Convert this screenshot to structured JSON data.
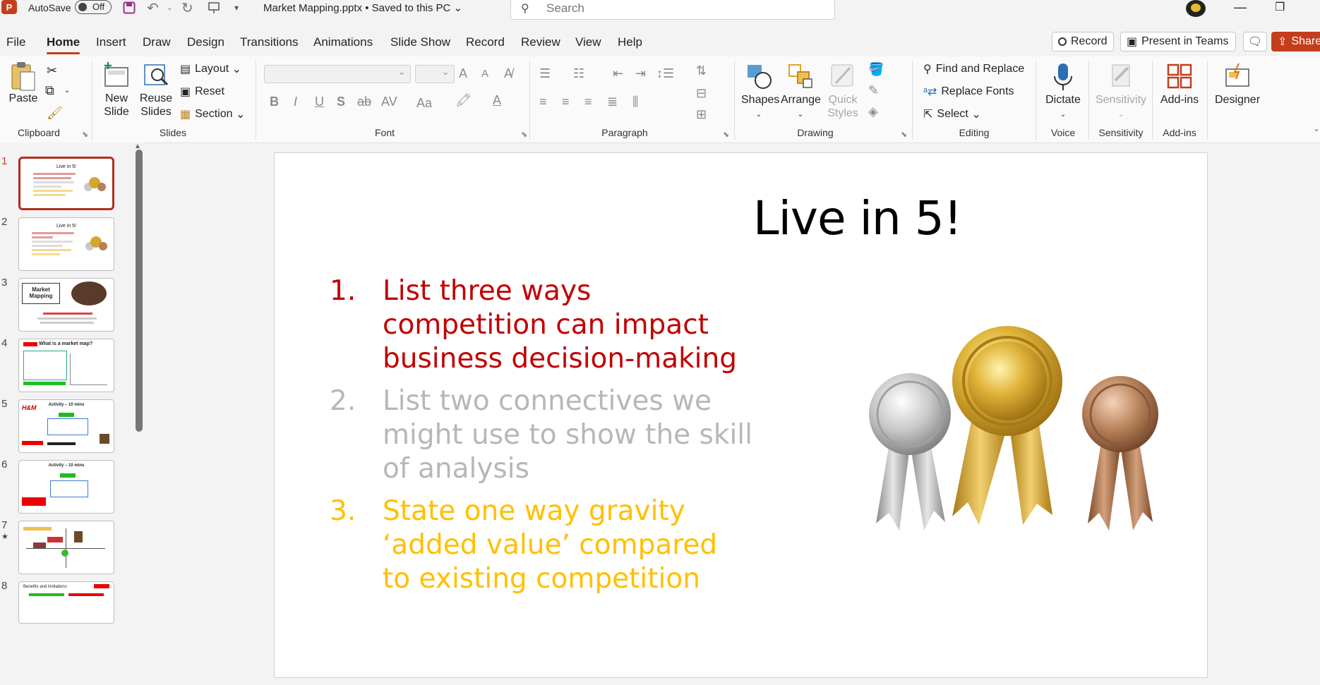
{
  "titlebar": {
    "app_logo": "P",
    "autosave_label": "AutoSave",
    "autosave_state": "Off",
    "doc_title": "Market Mapping.pptx • Saved to this PC ⌄",
    "search_placeholder": "Search",
    "icons": [
      "save-icon",
      "undo-icon",
      "redo-icon",
      "present-icon",
      "customize-qat-icon",
      "search-icon",
      "minimize-icon",
      "maximize-icon"
    ]
  },
  "menu": {
    "tabs": [
      "File",
      "Home",
      "Insert",
      "Draw",
      "Design",
      "Transitions",
      "Animations",
      "Slide Show",
      "Record",
      "Review",
      "View",
      "Help"
    ],
    "active_tab": "Home",
    "record_label": "Record",
    "teams_label": "Present in Teams",
    "share_label": "Share"
  },
  "ribbon": {
    "clipboard": {
      "paste": "Paste",
      "group": "Clipboard"
    },
    "slides": {
      "new_slide": "New Slide",
      "reuse_slides": "Reuse Slides",
      "layout": "Layout",
      "reset": "Reset",
      "section": "Section",
      "group": "Slides"
    },
    "font": {
      "group": "Font",
      "bold": "B",
      "italic": "I",
      "underline": "U",
      "shadow": "S",
      "strike": "ab",
      "spacing": "AV",
      "case": "Aa",
      "grow": "A",
      "shrink": "A"
    },
    "paragraph": {
      "group": "Paragraph"
    },
    "drawing": {
      "shapes": "Shapes",
      "arrange": "Arrange",
      "quick_styles": "Quick Styles",
      "group": "Drawing"
    },
    "editing": {
      "find_replace": "Find and Replace",
      "replace_fonts": "Replace Fonts",
      "select": "Select",
      "group": "Editing"
    },
    "voice": {
      "dictate": "Dictate",
      "group": "Voice"
    },
    "sensitivity": {
      "label": "Sensitivity",
      "group": "Sensitivity"
    },
    "addins": {
      "label": "Add-ins",
      "group": "Add-ins"
    },
    "designer": {
      "label": "Designer"
    }
  },
  "thumbnails": [
    {
      "num": "1",
      "title": "Live in 5!"
    },
    {
      "num": "2",
      "title": "Live in 5!"
    },
    {
      "num": "3",
      "title": "Market Mapping"
    },
    {
      "num": "4",
      "title": "What is a market map?"
    },
    {
      "num": "5",
      "title": "Activity – 10 mins"
    },
    {
      "num": "6",
      "title": "Activity – 10 mins"
    },
    {
      "num": "7",
      "title": ""
    },
    {
      "num": "8",
      "title": "Benefits and limitations"
    }
  ],
  "slide": {
    "title": "Live in 5!",
    "items": [
      {
        "num": "1.",
        "text": "List three ways competition can impact business decision-making"
      },
      {
        "num": "2.",
        "text": "List two connectives we might use to show the skill of analysis"
      },
      {
        "num": "3.",
        "text": "State one way gravity ‘added value’ compared to existing competition"
      }
    ]
  },
  "colors": {
    "accent": "#c43e1c",
    "item1": "#c00000",
    "item2": "#b7b7b7",
    "item3": "#ffc000"
  }
}
